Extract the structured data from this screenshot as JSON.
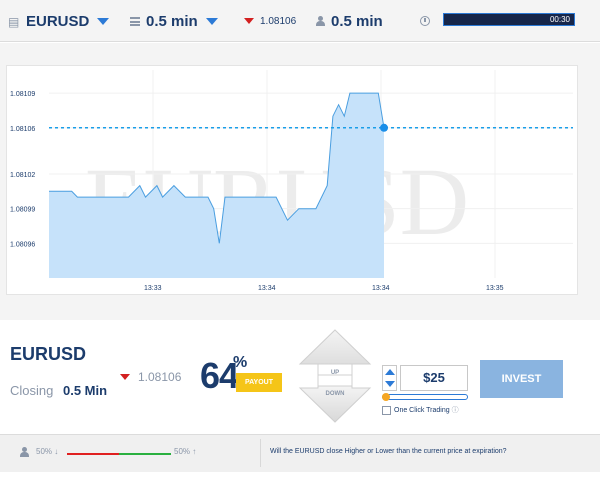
{
  "topbar": {
    "asset_label": "EURUSD",
    "expiry_label": "0.5 min",
    "price": "1.08106",
    "timer_label": "0.5 min",
    "countdown": "00:30",
    "icons": [
      "list-icon",
      "bars-icon",
      "down-arrow-icon",
      "person-icon",
      "clock-icon"
    ]
  },
  "chart_data": {
    "type": "area",
    "watermark": "EURUSD",
    "yticks": [
      "1.08109",
      "1.08106",
      "1.08102",
      "1.08099",
      "1.08096"
    ],
    "xticks": [
      "13:33",
      "13:34",
      "13:34",
      "13:35"
    ],
    "current_price": 1.08106,
    "series": [
      {
        "values": [
          [
            0,
            1.081005
          ],
          [
            4,
            1.081005
          ],
          [
            5,
            1.081
          ],
          [
            10,
            1.081
          ],
          [
            14,
            1.081
          ],
          [
            16,
            1.08101
          ],
          [
            17,
            1.081
          ],
          [
            19,
            1.08101
          ],
          [
            20,
            1.081
          ],
          [
            22,
            1.08101
          ],
          [
            24,
            1.081
          ],
          [
            28,
            1.081
          ],
          [
            29,
            1.08099
          ],
          [
            30,
            1.08096
          ],
          [
            31,
            1.081
          ],
          [
            40,
            1.081
          ],
          [
            42,
            1.08098
          ],
          [
            44,
            1.08099
          ],
          [
            47,
            1.08099
          ],
          [
            49,
            1.08101
          ],
          [
            50,
            1.08107
          ],
          [
            51,
            1.08108
          ],
          [
            52,
            1.08107
          ],
          [
            53,
            1.08109
          ],
          [
            56,
            1.08109
          ],
          [
            58,
            1.08109
          ],
          [
            59,
            1.08106
          ]
        ]
      }
    ],
    "colors": {
      "fill": "#c6e2fa",
      "line": "#4a9ee0",
      "current_line": "#1a9ee8",
      "point": "#1a8ee8"
    }
  },
  "panel": {
    "asset": "EURUSD",
    "closing_label": "Closing",
    "closing_value": "0.5 Min",
    "price": "1.08106",
    "payout_number": "64",
    "payout_percent": "%",
    "payout_badge": "PAYOUT",
    "up_label": "UP",
    "down_label": "DOWN",
    "amount": "$25",
    "one_click_label": "One Click Trading",
    "one_click_info": "ⓘ",
    "invest_label": "INVEST"
  },
  "bottom": {
    "left_pct": "50%",
    "left_arrow": "↓",
    "right_pct": "50%",
    "right_arrow": "↑",
    "question": "Will the EURUSD close Higher or Lower than the current price at expiration?"
  }
}
